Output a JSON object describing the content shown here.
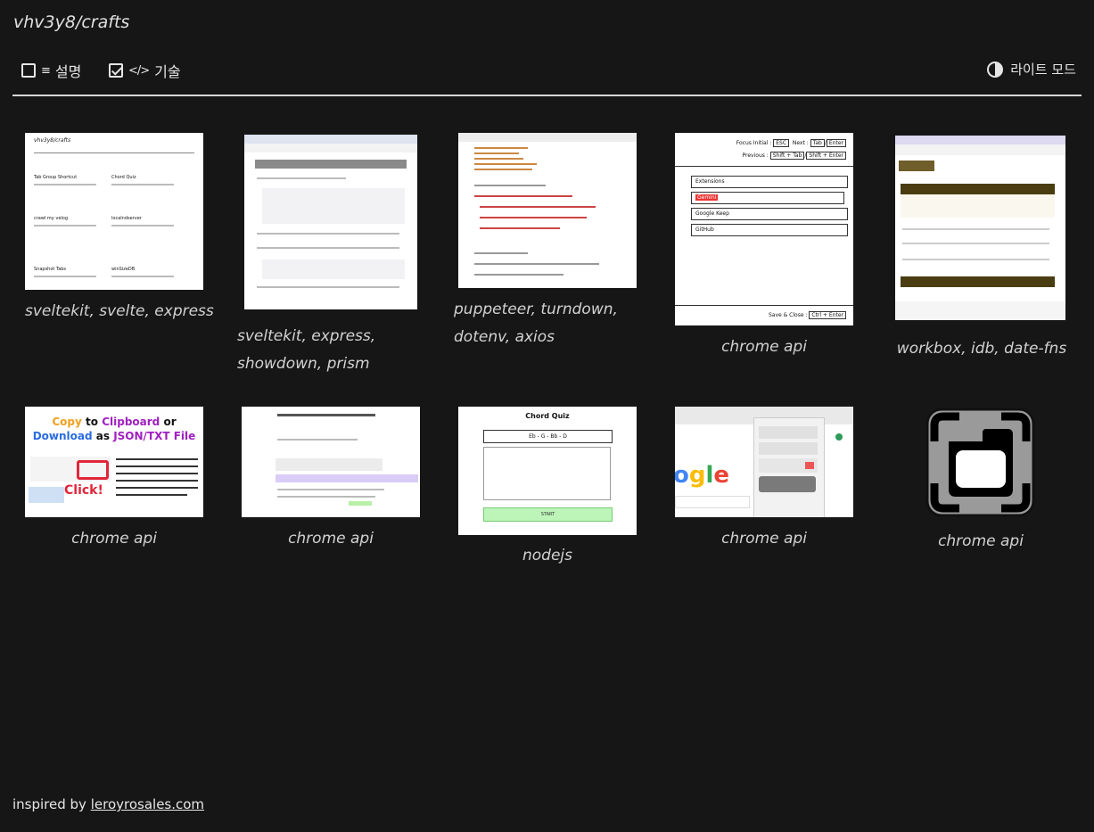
{
  "app": {
    "title": "vhv3y8/crafts"
  },
  "toolbar": {
    "description_label": "설명",
    "tech_label": "기술",
    "theme_label": "라이트 모드"
  },
  "cards": [
    {
      "caption_lines": [
        "sveltekit, svelte, express"
      ]
    },
    {
      "caption_lines": [
        "sveltekit, express,",
        "showdown, prism"
      ]
    },
    {
      "caption_lines": [
        "puppeteer, turndown,",
        "dotenv, axios"
      ]
    },
    {
      "caption_lines": [
        "chrome api"
      ]
    },
    {
      "caption_lines": [
        "workbox, idb, date-fns"
      ]
    },
    {
      "caption_lines": [
        "chrome api"
      ]
    },
    {
      "caption_lines": [
        "chrome api"
      ]
    },
    {
      "caption_lines": [
        "nodejs"
      ]
    },
    {
      "caption_lines": [
        "chrome api"
      ]
    },
    {
      "caption_lines": [
        "chrome api"
      ]
    }
  ],
  "thumb_text": {
    "t1_title": "vhv3y8/crafts",
    "t1_items": [
      "Tab Group Shortcut",
      "Chord Quiz",
      "crawl my velog",
      "localndserver",
      "Snapshot Tabs",
      "winSizeDB"
    ],
    "t4_focus": "Focus Initial :",
    "t4_esc": "ESC",
    "t4_next": "Next :",
    "t4_tab": "Tab",
    "t4_enter": "Enter",
    "t4_prev": "Previous :",
    "t4_shift_tab": "Shift + Tab",
    "t4_shift_enter": "Shift + Enter",
    "t4_items": [
      "Extensions",
      "Gemini",
      "Google Keep",
      "GitHub"
    ],
    "t4_save": "Save & Close :",
    "t4_ctrl": "Ctrl + Enter",
    "t6_copy": "Copy",
    "t6_to": "to",
    "t6_clipboard": "Clipboard",
    "t6_or": "or",
    "t6_download": "Download",
    "t6_as": "as",
    "t6_format": "JSON/TXT File",
    "t6_click": "Click!",
    "t8_title": "Chord Quiz",
    "t8_chord": "Eb - G - Bb - D",
    "t8_start": "START",
    "t9_logo": "ogle"
  },
  "footer": {
    "prefix": "inspired by",
    "link": "leroyrosales.com"
  },
  "colors": {
    "background": "#161616",
    "text": "#e6e6e6",
    "caption": "#d2d2d2",
    "workbox_header": "#4a3d12"
  },
  "icons": [
    "checkbox-icon",
    "text-lines-icon",
    "code-icon",
    "half-moon-icon"
  ]
}
